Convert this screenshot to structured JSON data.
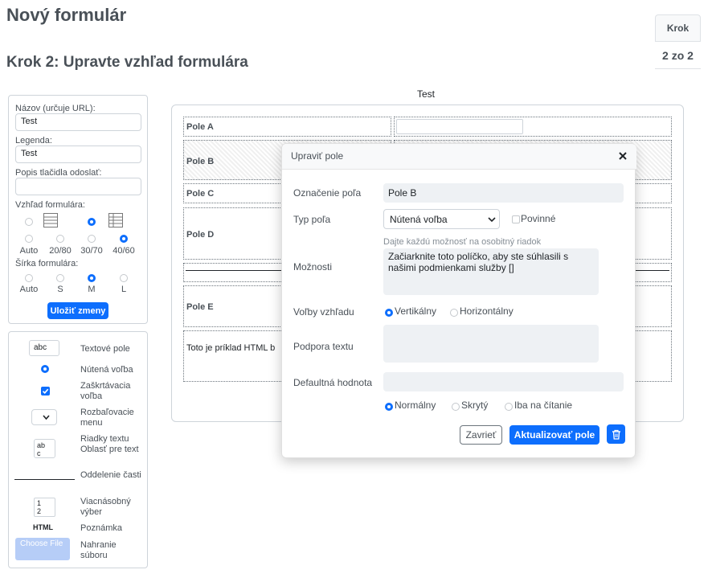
{
  "page": {
    "title": "Nový formulár",
    "subtitle": "Krok 2: Upravte vzhľad formulára",
    "step_label": "Krok",
    "step_value": "2 zo 2"
  },
  "settings": {
    "name_label": "Názov (určuje URL):",
    "name_value": "Test",
    "legend_label": "Legenda:",
    "legend_value": "Test",
    "submit_desc_label": "Popis tlačidla odoslať:",
    "submit_desc_value": "",
    "look_label": "Vzhľad formulára:",
    "look_options": [
      "Auto",
      "20/80",
      "30/70",
      "40/60"
    ],
    "look_selected": "40/60",
    "width_label": "Šírka formulára:",
    "width_options": [
      "Auto",
      "S",
      "M",
      "L"
    ],
    "width_selected": "M",
    "save_label": "Uložiť zmeny"
  },
  "toolbox": {
    "text_field_preview": "abc",
    "textarea_preview": "ab\nc",
    "multi_preview_1": "1",
    "multi_preview_2": "2",
    "html_preview": "HTML",
    "file_preview": "Choose File",
    "items": [
      "Textové pole",
      "Nútená voľba",
      "Zaškrtávacia voľba",
      "Rozbaľovacie menu",
      "Riadky textu Oblasť pre text",
      "Oddelenie časti",
      "Viacnásobný výber",
      "Poznámka",
      "Nahranie súboru"
    ]
  },
  "preview": {
    "legend": "Test",
    "rows": [
      "Pole A",
      "Pole B",
      "Pole C",
      "Pole D",
      "",
      "Pole E"
    ],
    "html_text": "Toto je príklad HTML b"
  },
  "modal": {
    "title": "Upraviť pole",
    "field_label_label": "Označenie poľa",
    "field_label_value": "Pole B",
    "type_label": "Typ poľa",
    "type_value": "Nútená voľba",
    "required_label": "Povinné",
    "options_hint": "Dajte každú možnosť na osobitný riadok",
    "options_label": "Možnosti",
    "options_value": "Začiarknite toto políčko, aby ste súhlasili s našimi podmienkami služby []",
    "layout_label": "Voľby vzhľadu",
    "layout_vertical": "Vertikálny",
    "layout_horizontal": "Horizontálny",
    "help_label": "Podpora textu",
    "help_value": "",
    "default_label": "Defaultná hodnota",
    "default_value": "",
    "state_normal": "Normálny",
    "state_hidden": "Skrytý",
    "state_readonly": "Iba na čítanie",
    "close_label": "Zavrieť",
    "update_label": "Aktualizovať pole"
  }
}
